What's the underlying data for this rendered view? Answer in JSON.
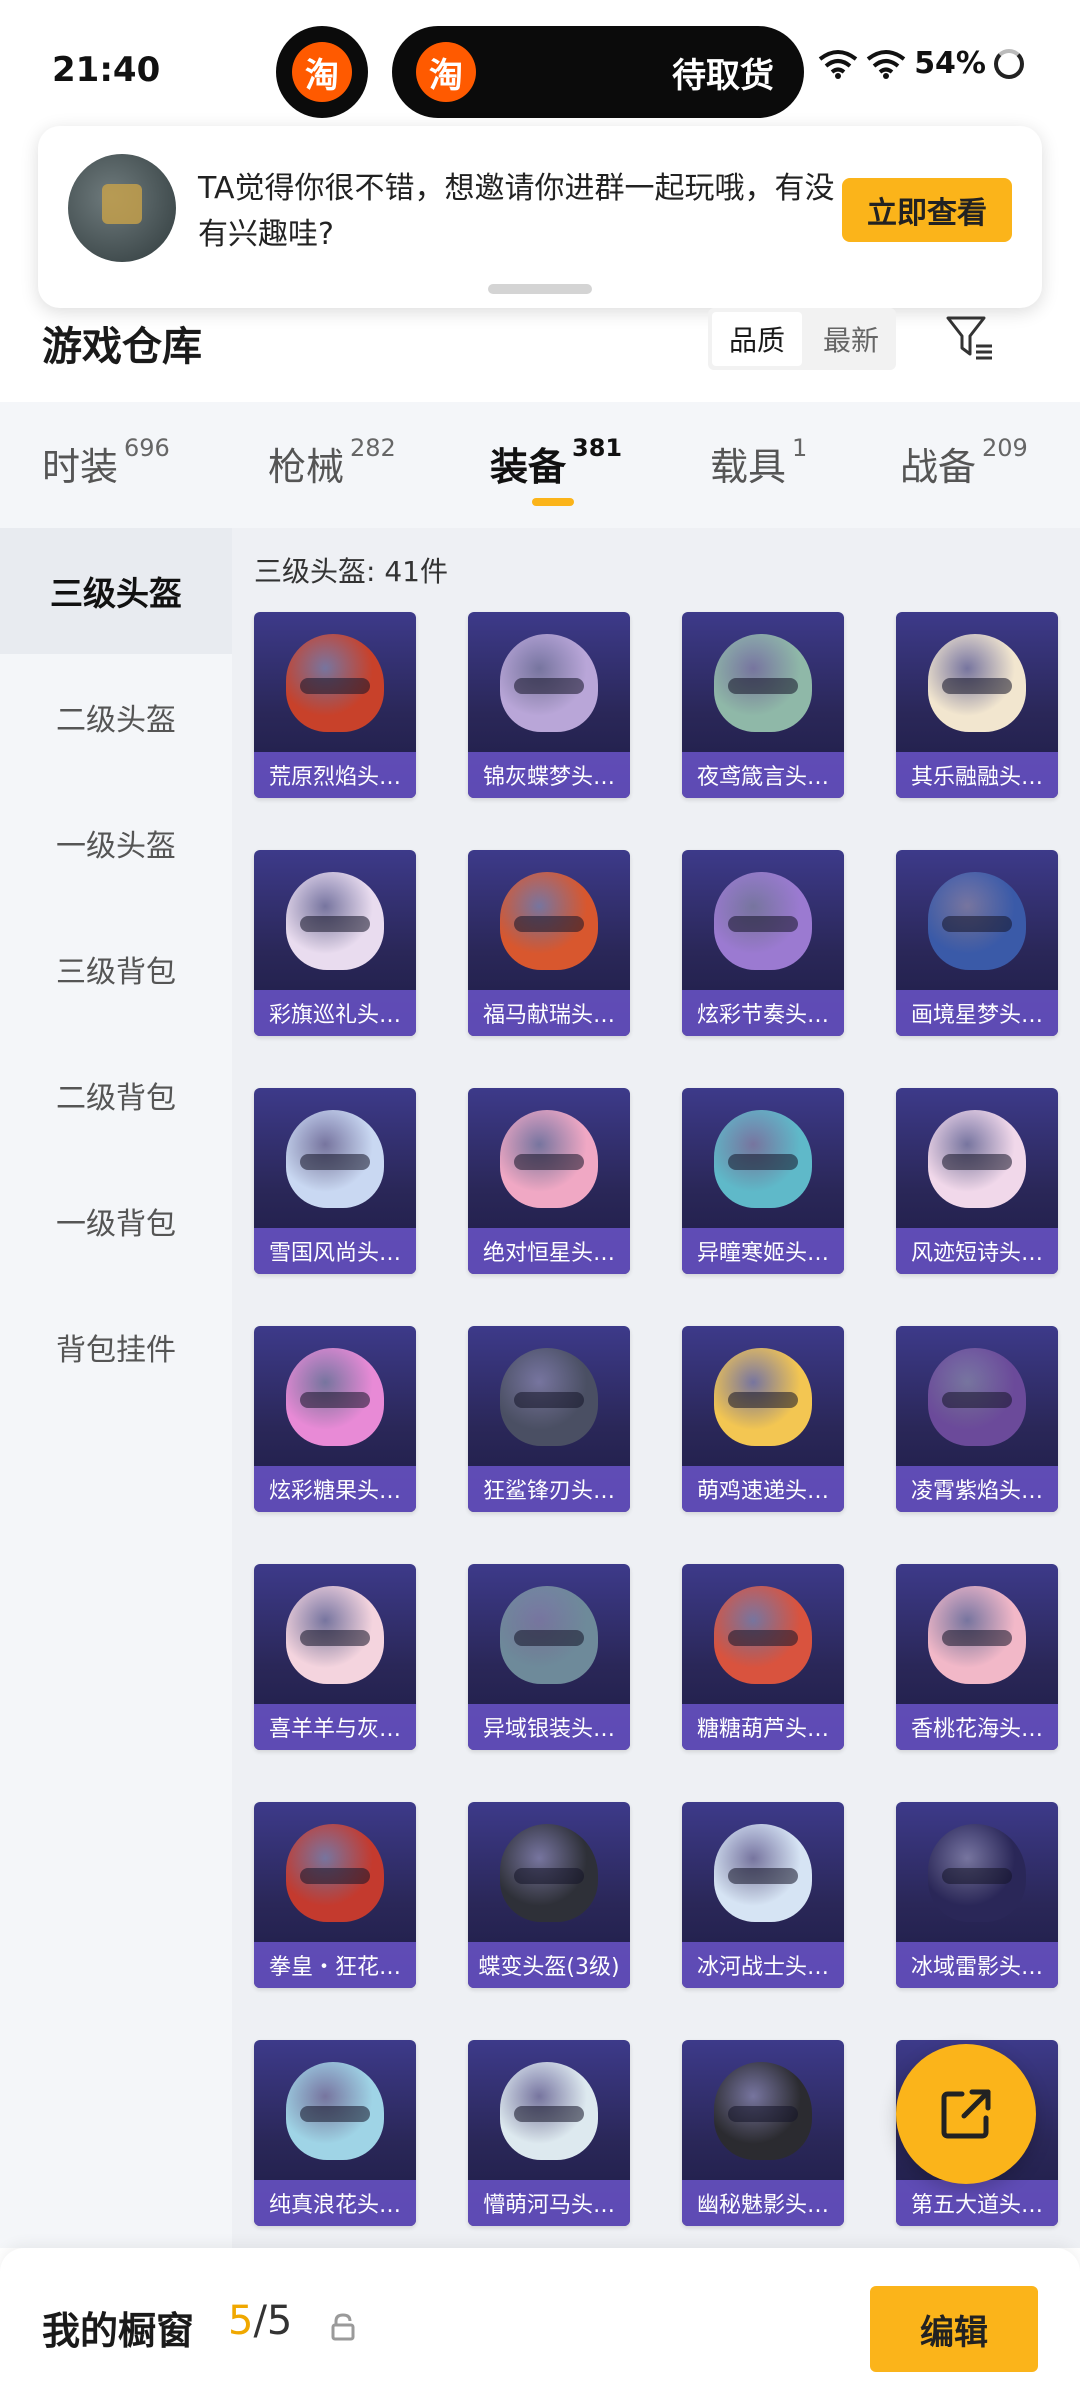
{
  "status_bar": {
    "time": "21:40",
    "taobao_icon": "淘",
    "pill_text": "待取货",
    "battery": "54%"
  },
  "notification": {
    "text": "TA觉得你很不错，想邀请你进群一起玩哦，有没有兴趣哇?",
    "button": "立即查看"
  },
  "header": {
    "title": "游戏仓库",
    "sort": {
      "quality": "品质",
      "newest": "最新"
    }
  },
  "tabs": [
    {
      "label": "时装",
      "count": "696"
    },
    {
      "label": "枪械",
      "count": "282"
    },
    {
      "label": "装备",
      "count": "381"
    },
    {
      "label": "载具",
      "count": "1"
    },
    {
      "label": "战备",
      "count": "209"
    }
  ],
  "sidebar": {
    "items": [
      "三级头盔",
      "二级头盔",
      "一级头盔",
      "三级背包",
      "二级背包",
      "一级背包",
      "背包挂件"
    ]
  },
  "grid": {
    "title": "三级头盔: 41件",
    "items": [
      {
        "name": "荒原烈焰头…",
        "color": "#c8412a"
      },
      {
        "name": "锦灰蝶梦头…",
        "color": "#b9a6d8"
      },
      {
        "name": "夜鸢箴言头…",
        "color": "#8fb8a8"
      },
      {
        "name": "其乐融融头…",
        "color": "#f2e6cf"
      },
      {
        "name": "彩旗巡礼头…",
        "color": "#e9dcef"
      },
      {
        "name": "福马献瑞头…",
        "color": "#d8572e"
      },
      {
        "name": "炫彩节奏头…",
        "color": "#9b7ad1"
      },
      {
        "name": "画境星梦头…",
        "color": "#3a5aa8"
      },
      {
        "name": "雪国风尚头…",
        "color": "#c9d8f2"
      },
      {
        "name": "绝对恒星头…",
        "color": "#f0a8c4"
      },
      {
        "name": "异瞳寒姬头…",
        "color": "#5fb9c9"
      },
      {
        "name": "风迹短诗头…",
        "color": "#f1d8ea"
      },
      {
        "name": "炫彩糖果头…",
        "color": "#e88ad6"
      },
      {
        "name": "狂鲨锋刃头…",
        "color": "#4a4f63"
      },
      {
        "name": "萌鸡速递头…",
        "color": "#f3c652"
      },
      {
        "name": "凌霄紫焰头…",
        "color": "#6b4a9a"
      },
      {
        "name": "喜羊羊与灰…",
        "color": "#f4d4de"
      },
      {
        "name": "异域银装头…",
        "color": "#6e8a9a"
      },
      {
        "name": "糖糖葫芦头…",
        "color": "#d9533e"
      },
      {
        "name": "香桃花海头…",
        "color": "#f2b8c8"
      },
      {
        "name": "拳皇・狂花…",
        "color": "#c43a2e"
      },
      {
        "name": "蝶变头盔(3级)",
        "color": "#2e3038"
      },
      {
        "name": "冰河战士头…",
        "color": "#d6e4f4"
      },
      {
        "name": "冰域雷影头…",
        "color": "#2a2758"
      },
      {
        "name": "纯真浪花头…",
        "color": "#9fd4e6"
      },
      {
        "name": "懵萌河马头…",
        "color": "#dde9ef"
      },
      {
        "name": "幽秘魅影头…",
        "color": "#2b2b30"
      },
      {
        "name": "第五大道头…",
        "color": "#e9d4a8"
      }
    ]
  },
  "bottom_bar": {
    "title": "我的橱窗",
    "count_current": "5",
    "count_total": "/5",
    "edit_button": "编辑"
  },
  "colors": {
    "accent": "#fbb41a",
    "card_bg": "#2a2758",
    "card_label": "#6a54c8",
    "sidebar_bg": "#f4f6f9"
  }
}
